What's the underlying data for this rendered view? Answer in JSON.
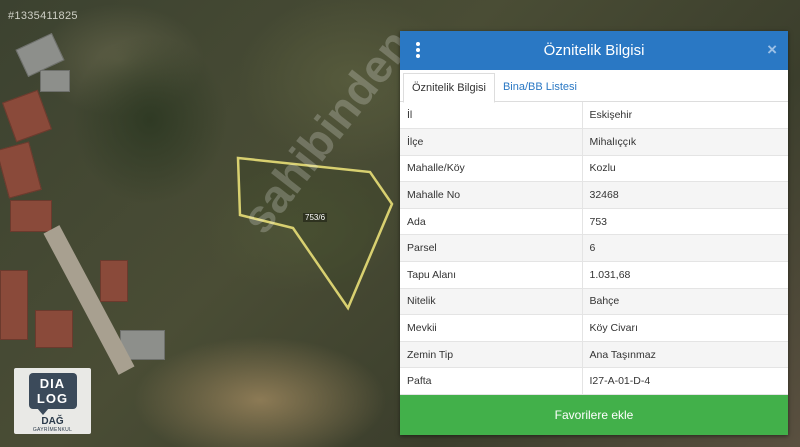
{
  "map": {
    "photo_id": "#1335411825",
    "site_watermark": "sahibinden",
    "parcel_label": "753/6"
  },
  "logo": {
    "line1": "DIA",
    "line2": "LOG",
    "name": "DAĞ",
    "subtitle": "GAYRİMENKUL"
  },
  "panel": {
    "title": "Öznitelik Bilgisi",
    "close_symbol": "×",
    "tabs": [
      {
        "label": "Öznitelik Bilgisi",
        "active": true
      },
      {
        "label": "Bina/BB Listesi",
        "active": false
      }
    ],
    "rows": [
      {
        "key": "İl",
        "value": "Eskişehir"
      },
      {
        "key": "İlçe",
        "value": "Mihalıççık"
      },
      {
        "key": "Mahalle/Köy",
        "value": "Kozlu"
      },
      {
        "key": "Mahalle No",
        "value": "32468"
      },
      {
        "key": "Ada",
        "value": "753"
      },
      {
        "key": "Parsel",
        "value": "6"
      },
      {
        "key": "Tapu Alanı",
        "value": "1.031,68"
      },
      {
        "key": "Nitelik",
        "value": "Bahçe"
      },
      {
        "key": "Mevkii",
        "value": "Köy Civarı"
      },
      {
        "key": "Zemin Tip",
        "value": "Ana Taşınmaz"
      },
      {
        "key": "Pafta",
        "value": "I27-A-01-D-4"
      }
    ],
    "favorite_button": "Favorilere ekle"
  },
  "colors": {
    "header": "#2a78c4",
    "button": "#42b04a",
    "parcel_outline": "#d8d070"
  }
}
